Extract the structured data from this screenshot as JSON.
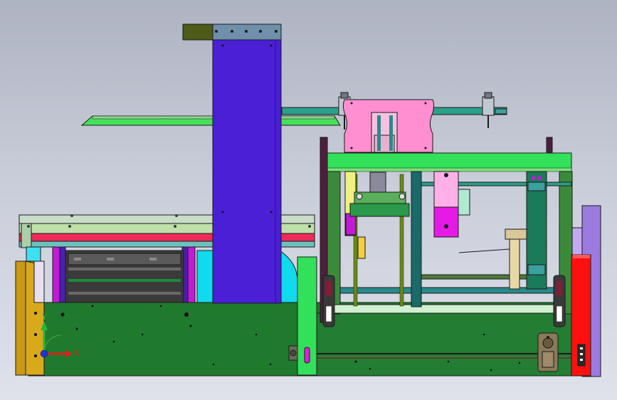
{
  "viewport": {
    "background_top": "#aeb3c2",
    "background_bottom": "#dfe2ea"
  },
  "colors": {
    "base_green": "#1f7a2e",
    "lime": "#33e05a",
    "purple_column": "#4b1fd6",
    "pink_block": "#ff8fd0",
    "red_panel": "#ff1010",
    "gold_panel": "#c99a12",
    "teal": "#1a8a7a",
    "cyan": "#11d9ee",
    "magenta": "#e61ae6",
    "lavender": "#9b7be0",
    "olive": "#4d5a18",
    "outline": "#1a1a1a"
  },
  "triad": {
    "x_label": "X",
    "y_label": "Y",
    "x_color": "#e0201c",
    "y_color": "#27b53a",
    "z_color": "#2233dd"
  }
}
